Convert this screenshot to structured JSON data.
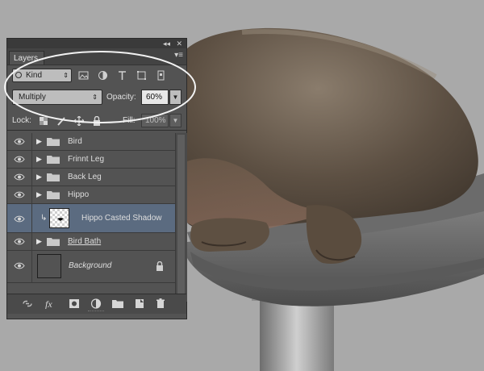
{
  "panel": {
    "tab_label": "Layers",
    "filter_kind": "Kind",
    "blend_mode": "Multiply",
    "opacity_label": "Opacity:",
    "opacity_value": "60%",
    "lock_label": "Lock:",
    "fill_label": "Fill:",
    "fill_value": "100%",
    "layers": [
      {
        "name": "Bird",
        "type": "group",
        "visible": true
      },
      {
        "name": "Frinnt Leg",
        "type": "group",
        "visible": true
      },
      {
        "name": "Back Leg",
        "type": "group",
        "visible": true
      },
      {
        "name": "Hippo",
        "type": "group",
        "visible": true
      },
      {
        "name": "Hippo Casted Shadow",
        "type": "pixel",
        "visible": true,
        "selected": true,
        "clipped": true
      },
      {
        "name": "Bird Bath",
        "type": "group",
        "visible": true
      },
      {
        "name": "Background",
        "type": "background",
        "visible": true,
        "locked": true
      }
    ]
  },
  "icons": {
    "collapse": "double-chevron-icon",
    "close": "close-icon",
    "panel_menu": "panel-menu-icon"
  },
  "colors": {
    "panel_bg": "#535353",
    "selected_row": "#5b6b80",
    "canvas_bg": "#a9a9a9"
  }
}
